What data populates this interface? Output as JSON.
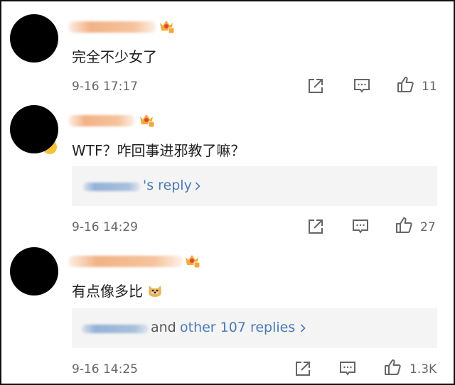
{
  "comments": [
    {
      "text": "完全不少女了",
      "timestamp": "9-16 17:17",
      "likes": "11",
      "badge_icon": "crown-level-badge-icon"
    },
    {
      "text": "WTF？咋回事进邪教了嘛？",
      "timestamp": "9-16 14:29",
      "likes": "27",
      "reply_link": "'s reply",
      "badge_icon": "crown-level-badge-icon"
    },
    {
      "text": "有点像多比",
      "timestamp": "9-16 14:25",
      "likes": "1.3K",
      "reply_prefix": "and",
      "reply_link": "other 107 replies",
      "badge_icon": "crown-level-badge-icon",
      "emoji": "doge-emoji-icon"
    }
  ],
  "colors": {
    "link": "#4a7bb7",
    "text": "#222222",
    "meta": "#666666",
    "reply_bg": "#f4f4f4",
    "badge": "#f2a93b"
  },
  "icons": [
    "share-icon",
    "comment-icon",
    "like-icon",
    "chevron-right-icon"
  ]
}
